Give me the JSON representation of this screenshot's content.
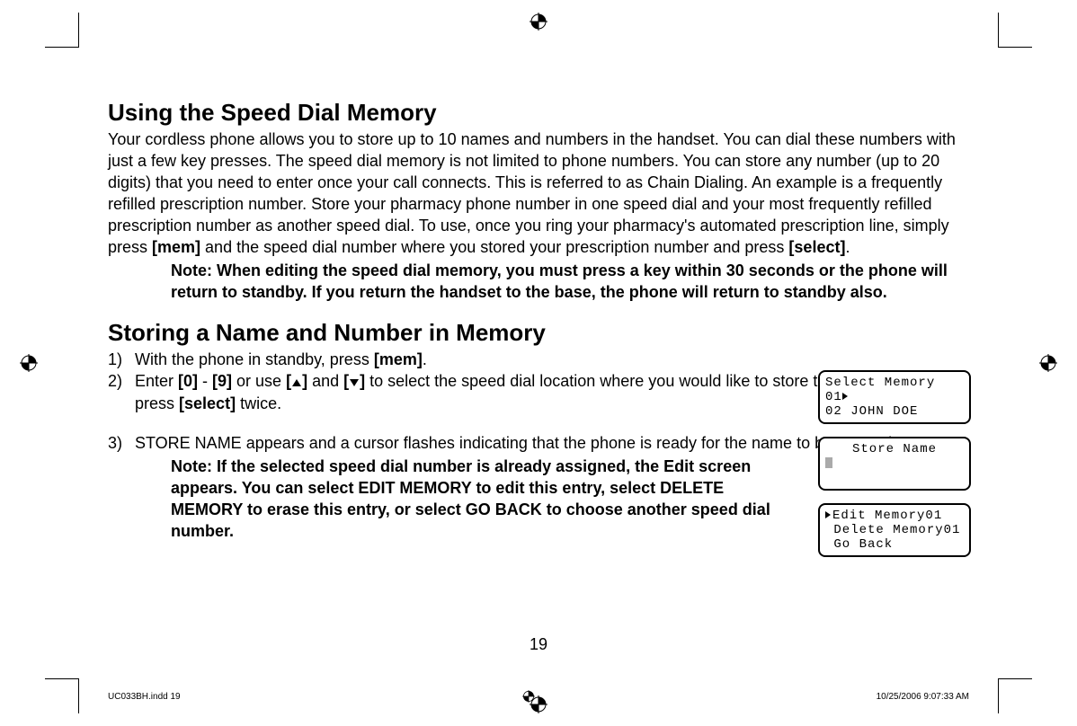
{
  "headings": {
    "h1": "Using the Speed Dial Memory",
    "h2": "Storing a Name and Number in Memory"
  },
  "paragraphs": {
    "intro_pre": "Your cordless phone allows you to store up to 10 names and numbers in the handset. You can dial these numbers with just a few key presses. The speed dial memory is not limited to phone numbers. You can store any number (up to 20 digits) that you need to enter once your call connects. This is referred to as Chain Dialing. An example is a frequently refilled prescription number. Store your pharmacy phone number in one speed dial and your most frequently refilled prescription number as another speed dial. To use, once you ring your pharmacy's automated prescription line, simply press ",
    "mem": "[mem]",
    "intro_mid": " and the speed dial number where you stored your prescription number and press ",
    "select": "[select]",
    "intro_end": ".",
    "note1": "Note: When editing the speed dial memory, you must press a key within 30 seconds or the phone will return to standby. If you return the handset to the base, the phone will return to standby also."
  },
  "steps": {
    "n1": "1)",
    "t1_a": "With the phone in standby, press ",
    "t1_b": "[mem]",
    "t1_c": ".",
    "n2": "2)",
    "t2_a": "Enter ",
    "t2_b": "[0]",
    "t2_c": " - ",
    "t2_d": "[9]",
    "t2_e": " or use ",
    "t2_f": "[",
    "t2_g": "]",
    "t2_h": " and ",
    "t2_i": "[",
    "t2_j": "]",
    "t2_k": " to select the speed dial location where you would like to store this entry, and then press ",
    "t2_l": "[select]",
    "t2_m": " twice.",
    "n3": "3)",
    "t3": "STORE NAME appears and a cursor flashes indicating that the phone is ready for the name to be entered.",
    "note2": "Note: If the selected speed dial number is already assigned, the Edit screen appears. You can select EDIT MEMORY to edit this entry, select DELETE MEMORY to erase this entry, or select GO BACK to choose another speed dial number."
  },
  "lcd": {
    "screen1_l1": "Select Memory",
    "screen1_l2": "01",
    "screen1_l3": "02 JOHN DOE",
    "screen2_l1": "Store Name",
    "screen3_l1": "Edit Memory01",
    "screen3_l2": " Delete Memory01",
    "screen3_l3": " Go Back"
  },
  "page_number": "19",
  "footer": {
    "left": "UC033BH.indd   19",
    "right": "10/25/2006   9:07:33 AM"
  }
}
